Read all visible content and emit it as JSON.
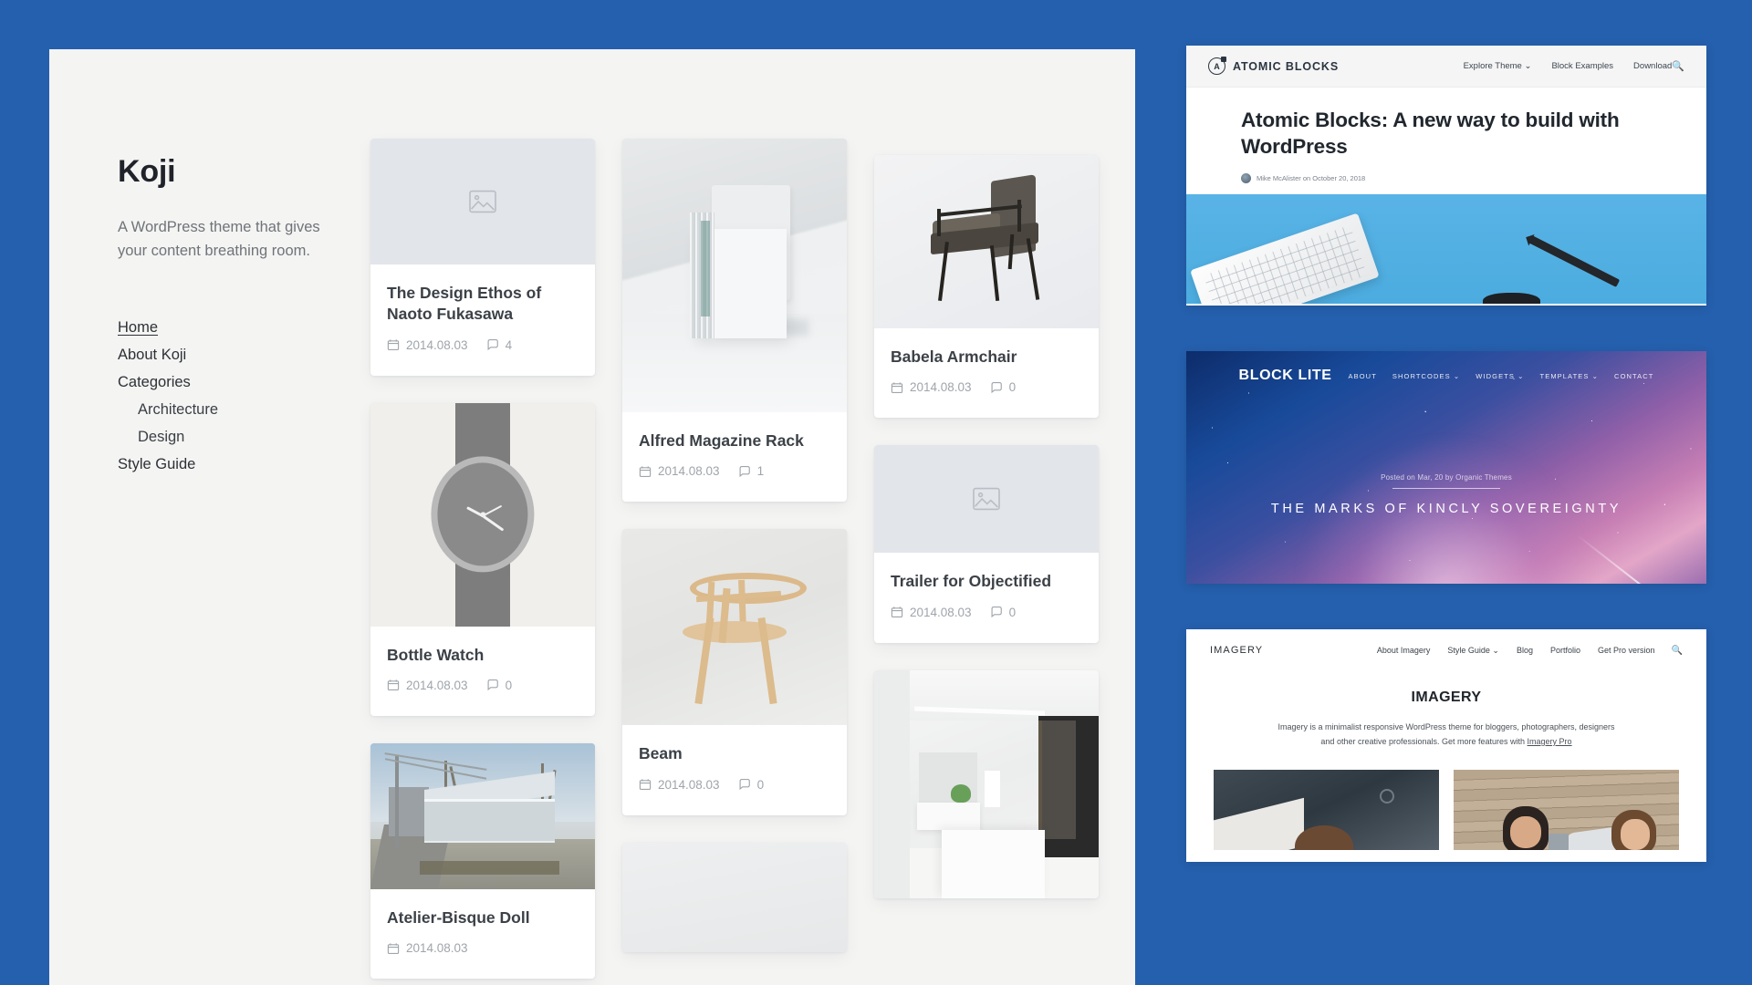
{
  "page": {
    "background_color": "#2560ae"
  },
  "koji": {
    "site_title": "Koji",
    "tagline": "A WordPress theme that gives your content breathing room.",
    "nav": [
      {
        "label": "Home",
        "current": true,
        "sub": false
      },
      {
        "label": "About Koji",
        "current": false,
        "sub": false
      },
      {
        "label": "Categories",
        "current": false,
        "sub": false
      },
      {
        "label": "Architecture",
        "current": false,
        "sub": true
      },
      {
        "label": "Design",
        "current": false,
        "sub": true
      },
      {
        "label": "Style Guide",
        "current": false,
        "sub": false
      }
    ],
    "icons": {
      "date": "calendar-icon",
      "comments": "comment-icon",
      "placeholder": "image-placeholder-icon"
    },
    "columns": [
      {
        "cards": [
          {
            "title": "The Design Ethos of Naoto Fukasawa",
            "date": "2014.08.03",
            "comments": "4",
            "media": "placeholder",
            "media_height": 138
          },
          {
            "title": "Bottle Watch",
            "date": "2014.08.03",
            "comments": "0",
            "media": "watch",
            "media_height": 245
          },
          {
            "title": "Atelier-Bisque Doll",
            "date": "2014.08.03",
            "comments": "",
            "media": "house",
            "media_height": 160
          }
        ]
      },
      {
        "cards": [
          {
            "title": "Alfred Magazine Rack",
            "date": "2014.08.03",
            "comments": "1",
            "media": "magazine-rack",
            "media_height": 300
          },
          {
            "title": "Beam",
            "date": "2014.08.03",
            "comments": "0",
            "media": "beam",
            "media_height": 215
          },
          {
            "title": "",
            "date": "",
            "comments": "",
            "media": "plain",
            "media_height": 120
          }
        ]
      },
      {
        "cards": [
          {
            "title": "Babela Armchair",
            "date": "2014.08.03",
            "comments": "0",
            "media": "armchair",
            "media_height": 190
          },
          {
            "title": "Trailer for Objectified",
            "date": "2014.08.03",
            "comments": "0",
            "media": "placeholder",
            "media_height": 118
          },
          {
            "title": "",
            "date": "",
            "comments": "",
            "media": "interior",
            "media_height": 250
          }
        ]
      }
    ]
  },
  "atomic_blocks": {
    "brand": "ATOMIC BLOCKS",
    "logo_letter": "A",
    "nav": [
      "Explore Theme ⌄",
      "Block Examples",
      "Download"
    ],
    "search_icon": "search-icon",
    "headline": "Atomic Blocks: A new way to build with WordPress",
    "byline": "Mike McAlister on October 20, 2018"
  },
  "block_lite": {
    "brand": "BLOCK LITE",
    "nav": [
      "ABOUT",
      "SHORTCODES ⌄",
      "WIDGETS ⌄",
      "TEMPLATES ⌄",
      "CONTACT"
    ],
    "kicker": "Posted on Mar, 20 by Organic Themes",
    "headline": "THE MARKS OF KINCLY SOVEREIGNTY"
  },
  "imagery": {
    "brand": "IMAGERY",
    "nav": [
      "About Imagery",
      "Style Guide ⌄",
      "Blog",
      "Portfolio",
      "Get Pro version"
    ],
    "search_icon": "search-icon",
    "headline": "IMAGERY",
    "description_part1": "Imagery is a minimalist responsive WordPress theme for bloggers, photographers, designers and other creative professionals. Get more features with ",
    "description_link": "Imagery Pro"
  }
}
